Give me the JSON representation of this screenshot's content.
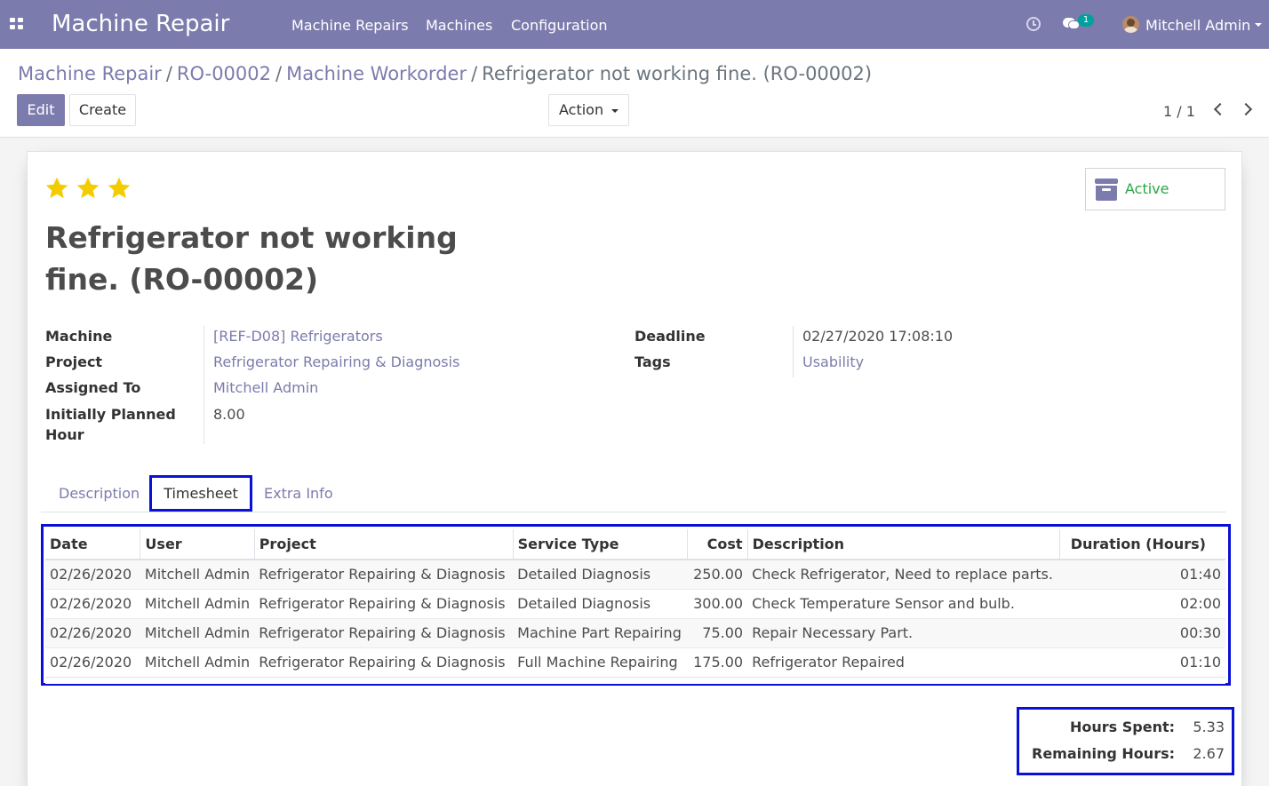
{
  "navbar": {
    "brand": "Machine Repair",
    "menu": [
      "Machine Repairs",
      "Machines",
      "Configuration"
    ],
    "chat_badge": "1",
    "user": "Mitchell Admin"
  },
  "breadcrumb": {
    "items": [
      "Machine Repair",
      "RO-00002",
      "Machine Workorder"
    ],
    "active": "Refrigerator not working fine. (RO-00002)",
    "sep": "/"
  },
  "toolbar": {
    "edit": "Edit",
    "create": "Create",
    "action": "Action",
    "pager": "1 / 1"
  },
  "record": {
    "priority_stars": 3,
    "archive_label": "Active",
    "title": "Refrigerator not working fine. (RO-00002)",
    "fields_left": [
      {
        "label": "Machine",
        "value": "[REF-D08] Refrigerators"
      },
      {
        "label": "Project",
        "value": "Refrigerator Repairing & Diagnosis"
      },
      {
        "label": "Assigned To",
        "value": "Mitchell Admin"
      },
      {
        "label": "Initially Planned Hour",
        "value": "8.00"
      }
    ],
    "fields_right": [
      {
        "label": "Deadline",
        "value": "02/27/2020 17:08:10"
      },
      {
        "label": "Tags",
        "value": "Usability"
      }
    ]
  },
  "tabs": [
    "Description",
    "Timesheet",
    "Extra Info"
  ],
  "timesheet": {
    "columns": [
      "Date",
      "User",
      "Project",
      "Service Type",
      "Cost",
      "Description",
      "Duration (Hours)"
    ],
    "rows": [
      {
        "date": "02/26/2020",
        "user": "Mitchell Admin",
        "project": "Refrigerator Repairing & Diagnosis",
        "service": "Detailed Diagnosis",
        "cost": "250.00",
        "description": "Check Refrigerator, Need to replace parts.",
        "duration": "01:40"
      },
      {
        "date": "02/26/2020",
        "user": "Mitchell Admin",
        "project": "Refrigerator Repairing & Diagnosis",
        "service": "Detailed Diagnosis",
        "cost": "300.00",
        "description": "Check Temperature Sensor and bulb.",
        "duration": "02:00"
      },
      {
        "date": "02/26/2020",
        "user": "Mitchell Admin",
        "project": "Refrigerator Repairing & Diagnosis",
        "service": "Machine Part Repairing",
        "cost": "75.00",
        "description": "Repair Necessary Part.",
        "duration": "00:30"
      },
      {
        "date": "02/26/2020",
        "user": "Mitchell Admin",
        "project": "Refrigerator Repairing & Diagnosis",
        "service": "Full Machine Repairing",
        "cost": "175.00",
        "description": "Refrigerator Repaired",
        "duration": "01:10"
      }
    ]
  },
  "totals": {
    "hours_spent_label": "Hours Spent:",
    "hours_spent": "5.33",
    "remaining_label": "Remaining Hours:",
    "remaining": "2.67"
  },
  "colors": {
    "brand": "#7c7bad",
    "highlight": "#0a10d8",
    "star": "#f3cc00",
    "active": "#28a745"
  }
}
